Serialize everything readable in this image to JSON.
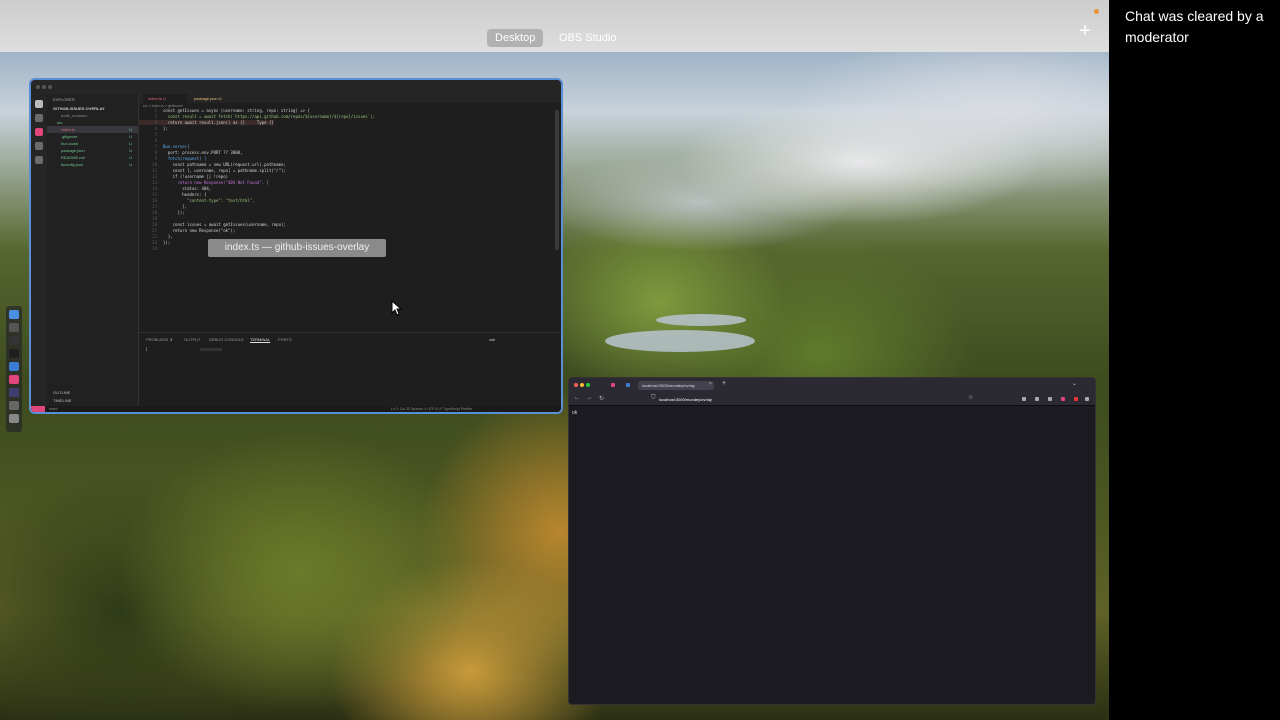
{
  "topbar": {
    "tabs": [
      {
        "label": "Desktop",
        "active": true
      },
      {
        "label": "OBS Studio",
        "active": false
      }
    ],
    "add_icon": "plus-icon"
  },
  "chat": {
    "message": "Chat was cleared by a moderator"
  },
  "vscode": {
    "explorer_title": "EXPLORER",
    "root_folder": "GITHUB-ISSUES-OVERLAY",
    "files": [
      {
        "name": "node_modules",
        "status": ""
      },
      {
        "name": "src",
        "status": ""
      },
      {
        "name": "index.ts",
        "status": "U"
      },
      {
        "name": ".gitignore",
        "status": "U"
      },
      {
        "name": "bun.lockb",
        "status": "U"
      },
      {
        "name": "package.json",
        "status": "U"
      },
      {
        "name": "README.md",
        "status": "U"
      },
      {
        "name": "tsconfig.json",
        "status": "U"
      }
    ],
    "outline_label": "OUTLINE",
    "timeline_label": "TIMELINE",
    "tabs": [
      {
        "label": "index.ts U"
      },
      {
        "label": "package.json U"
      }
    ],
    "breadcrumb": "src > index.ts > getIssues",
    "code": [
      "const getIssues = async (username: string, repo: string) => {",
      "  const result = await fetch(`https://api.github.com/repos/${username}/${repo}/issues`);",
      "  return await result.json() as {}     Type {}",
      "};",
      "",
      "",
      "Bun.serve({",
      "  port: process.env.PORT ?? 3000,",
      "  fetch(request) {",
      "    const pathname = new URL(request.url).pathname;",
      "    const [, username, repo] = pathname.split(\"/\");",
      "    if (!username || !repo)",
      "      return new Response(\"404 Not Found\", {",
      "        status: 404,",
      "        headers: {",
      "          \"content-type\": \"text/html\",",
      "        },",
      "      });",
      "",
      "    const issues = await getIssues(username, repo);",
      "    return new Response(\"ok\");",
      "  },",
      "});",
      ""
    ],
    "tooltip": "index.ts — github-issues-overlay",
    "panel_tabs": [
      "PROBLEMS",
      "OUTPUT",
      "DEBUG CONSOLE",
      "TERMINAL",
      "PORTS"
    ],
    "problems_count": "3",
    "terminal_label": "zsh",
    "terminal_text": "]",
    "status_left": "main*",
    "status_right": "Ln 3, Col 30   Spaces: 4   UTF-8   LF   TypeScript   Prettier"
  },
  "browser": {
    "tab_title": "localhost:3000/mundey/ovrlay",
    "url": "localhost:3000/mundey/ovrlay",
    "body_text": "ok"
  },
  "colors": {
    "vscode_border": "#5a8fd6",
    "accent_pink": "#e0457b",
    "git_untracked": "#73c991"
  }
}
